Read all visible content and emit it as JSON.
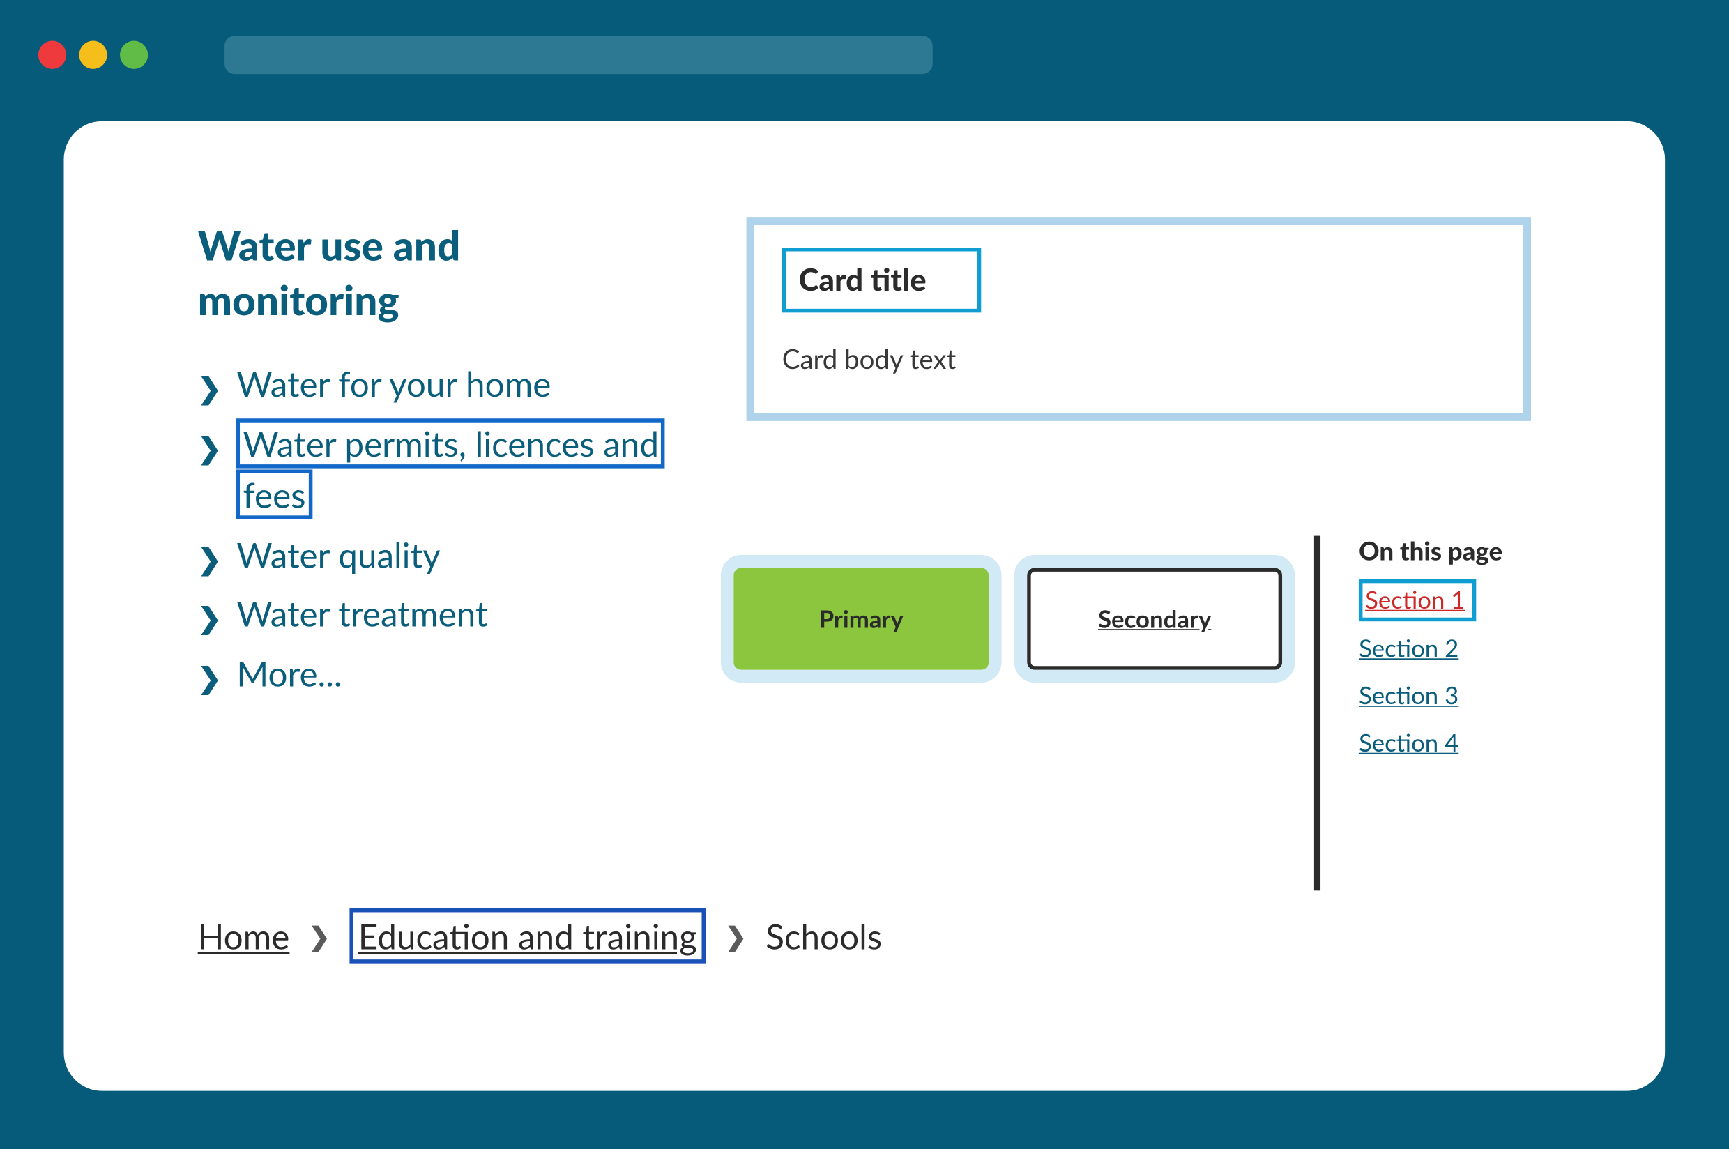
{
  "sidebar": {
    "title": "Water use and monitoring",
    "items": [
      {
        "label": "Water for your home",
        "focused": false
      },
      {
        "label": "Water permits, licences and fees",
        "focused": true
      },
      {
        "label": "Water quality",
        "focused": false
      },
      {
        "label": "Water treatment",
        "focused": false
      },
      {
        "label": "More...",
        "focused": false
      }
    ]
  },
  "card": {
    "title": "Card title",
    "body": "Card body text"
  },
  "buttons": {
    "primary": "Primary",
    "secondary": "Secondary"
  },
  "on_this_page": {
    "title": "On this page",
    "links": [
      "Section 1",
      "Section 2",
      "Section 3",
      "Section 4"
    ],
    "active_index": 0
  },
  "breadcrumb": {
    "items": [
      {
        "label": "Home",
        "focused": false,
        "current": false
      },
      {
        "label": "Education and training",
        "focused": true,
        "current": false
      },
      {
        "label": "Schools",
        "focused": false,
        "current": true
      }
    ]
  }
}
